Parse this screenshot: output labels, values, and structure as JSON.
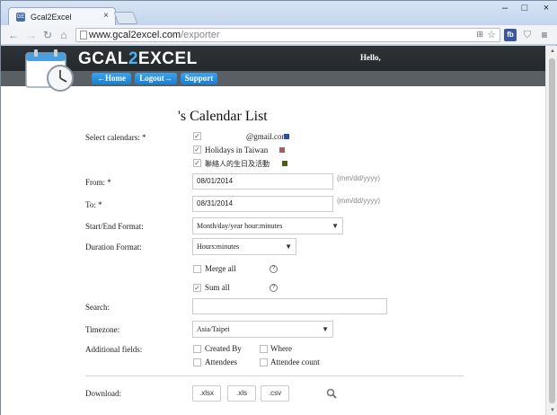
{
  "browser": {
    "tab_title": "Gcal2Excel",
    "tab_favicon": "GE",
    "tab_close": "×",
    "url_host": "www.gcal2excel.com",
    "url_path": "/exporter",
    "ext_fb": "fb",
    "win_min": "–",
    "win_max": "□",
    "win_close": "×",
    "nav_back": "←",
    "nav_forward": "→",
    "nav_reload": "↻",
    "nav_home": "⌂",
    "star": "☆",
    "translate": "⊞",
    "shield": "⛉",
    "menu": "≡",
    "scroll_up": "▲",
    "scroll_down": "▼"
  },
  "site": {
    "brand_prefix": "GCAL",
    "brand_two": "2",
    "brand_suffix": "EXCEL",
    "hello": "Hello,",
    "nav": {
      "home": "←Home",
      "logout": "Logout→",
      "support": "Support"
    }
  },
  "page": {
    "title": "'s Calendar List"
  },
  "form": {
    "select_calendars_label": "Select calendars:  *",
    "calendars": [
      {
        "name": "@gmail.com",
        "checked": "✓",
        "color": "#2952a3"
      },
      {
        "name": "Holidays in Taiwan",
        "checked": "✓",
        "color": "#a36262"
      },
      {
        "name": "聯絡人的生日及活動",
        "checked": "✓",
        "color": "#4a5e1a"
      }
    ],
    "from_label": "From:  *",
    "from_value": "08/01/2014",
    "from_hint": "(mm/dd/yyyy)",
    "to_label": "To:  *",
    "to_value": "08/31/2014",
    "to_hint": "(mm/dd/yyyy)",
    "startend_label": "Start/End Format:",
    "startend_value": "Month/day/year hour:minutes",
    "duration_label": "Duration Format:",
    "duration_value": "Hours:minutes",
    "caret": "▼",
    "merge_all": "Merge all",
    "merge_checked": "",
    "sum_all": "Sum all",
    "sum_checked": "✓",
    "help": "?",
    "search_label": "Search:",
    "search_value": "",
    "timezone_label": "Timezone:",
    "timezone_value": "Asia/Taipei",
    "additional_label": "Additional fields:",
    "fields": {
      "created_by": "Created By",
      "where": "Where",
      "attendees": "Attendees",
      "attendee_count": "Attendee count"
    },
    "download_label": "Download:",
    "download": {
      "xlsx": ".xlsx",
      "xls": ".xls",
      "csv": ".csv"
    }
  },
  "colors": {
    "accent": "#1a7fd0",
    "brand_two": "#4bb3ec",
    "header_bg": "#2e3338"
  }
}
